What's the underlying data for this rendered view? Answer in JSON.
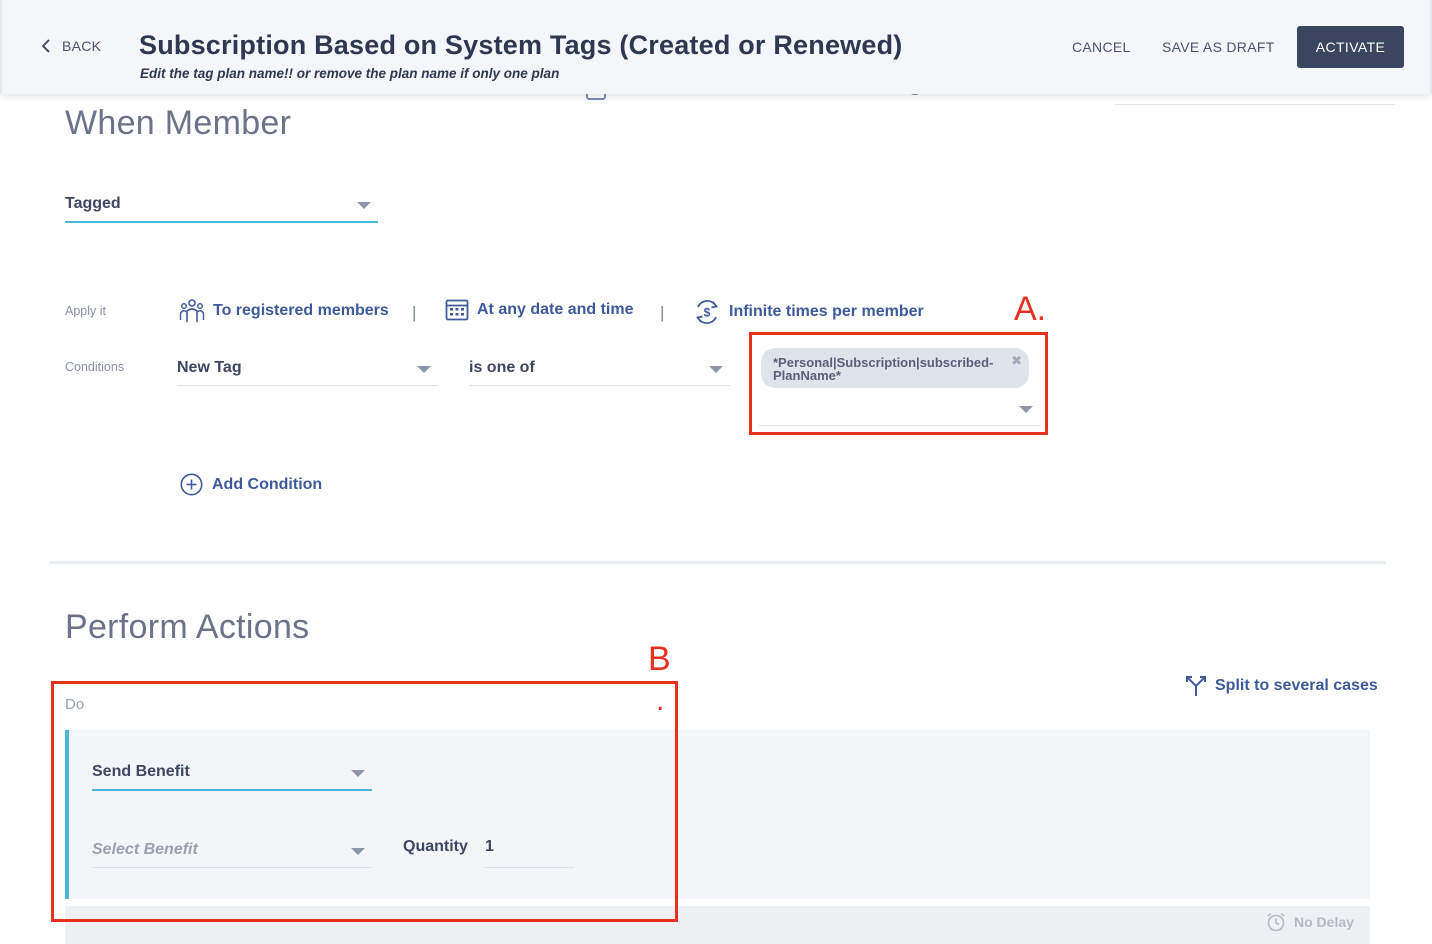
{
  "header": {
    "back_label": "BACK",
    "title": "Subscription Based on System Tags (Created or Renewed)",
    "subtitle": "Edit the tag plan name!! or remove the plan name if only one plan",
    "cancel_label": "CANCEL",
    "save_draft_label": "SAVE AS DRAFT",
    "activate_label": "ACTIVATE"
  },
  "when_section": {
    "title": "When Member",
    "trigger_value": "Tagged",
    "apply_label": "Apply it",
    "apply_items": [
      {
        "label": "To registered members",
        "icon": "members-icon"
      },
      {
        "label": "At any date and time",
        "icon": "calendar-icon"
      },
      {
        "label": "Infinite times per member",
        "icon": "recurring-dollar-icon"
      }
    ],
    "separator": "|",
    "conditions_label": "Conditions",
    "condition": {
      "field": "New Tag",
      "operator": "is one of",
      "tag_value": "*Personal|Subscription|subscribed-PlanName*"
    },
    "add_condition_label": "Add Condition"
  },
  "actions_section": {
    "title": "Perform Actions",
    "do_label": "Do",
    "split_label": "Split to several cases",
    "action_type": "Send Benefit",
    "benefit_placeholder": "Select Benefit",
    "quantity_label": "Quantity",
    "quantity_value": "1",
    "delay_label": "No Delay"
  },
  "annotations": {
    "a_label": "A.",
    "b_label": "B",
    "b_dot": ".",
    "color": "#e8301f"
  },
  "colors": {
    "accent": "#4ab7d6",
    "link": "#3e5a9a",
    "primary_button": "#3a4660"
  }
}
